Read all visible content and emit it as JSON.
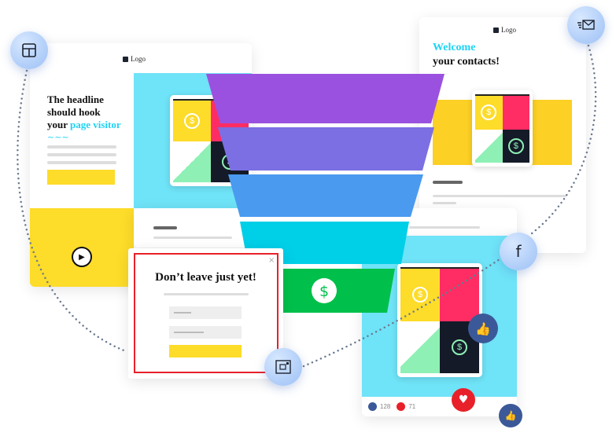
{
  "landing_card": {
    "logo": "Logo",
    "headline_1": "The headline",
    "headline_2": "should hook",
    "headline_3a": "your ",
    "headline_3b": "page visitor"
  },
  "email_card": {
    "logo": "Logo",
    "title_accent": "Welcome",
    "title": "your contacts!"
  },
  "popup": {
    "title": "Don’t leave just yet!",
    "close": "×"
  },
  "social_card": {
    "likes": "128",
    "hearts": "71"
  },
  "icons": {
    "landing": "layout-icon",
    "email": "mail-icon",
    "popup": "popup-icon",
    "social": "facebook-icon",
    "funnel_bottom": "dollar-icon"
  },
  "colors": {
    "funnel": [
      "#9b51e0",
      "#7b6fe3",
      "#4a9af0",
      "#00cfe8",
      "#00c04b"
    ],
    "accent": "#1ed3f5",
    "yellow": "#fddc2a",
    "red": "#e8202a",
    "facebook": "#3b5998"
  }
}
